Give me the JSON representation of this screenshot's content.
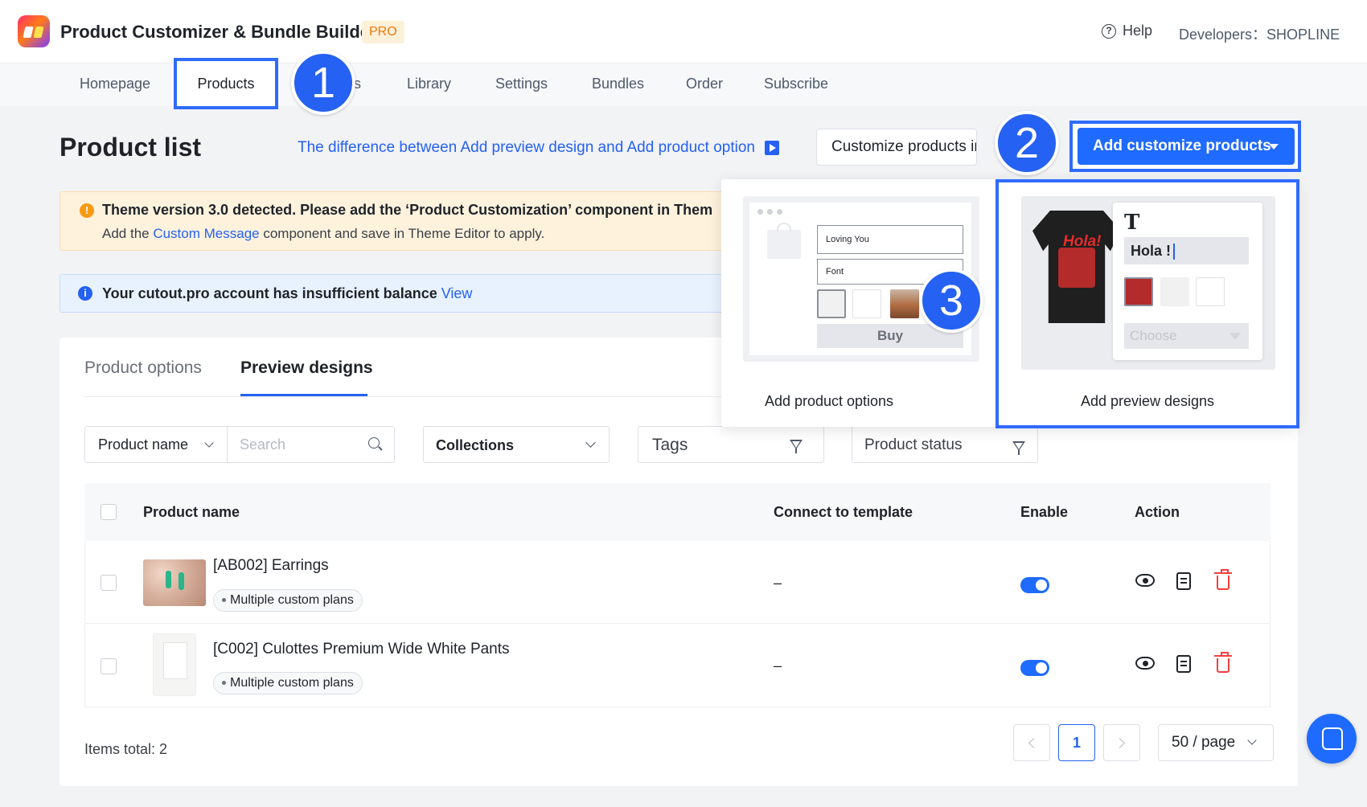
{
  "app": {
    "title": "Product Customizer & Bundle Builder",
    "badge": "PRO"
  },
  "header": {
    "help_label": "Help",
    "developers_label": "Developers：SHOPLINE"
  },
  "nav": {
    "items": [
      "Homepage",
      "Products",
      "s",
      "Library",
      "Settings",
      "Bundles",
      "Order",
      "Subscribe"
    ],
    "active": "Products"
  },
  "callouts": [
    "1",
    "2",
    "3"
  ],
  "page": {
    "title": "Product list",
    "difference_link": "The difference between Add preview design and Add product option",
    "bulk_button": "Customize products in b",
    "add_button": "Add customize products"
  },
  "warning": {
    "title": "Theme version 3.0 detected. Please add the ‘Product Customization’ component in Them",
    "sub_before": "Add the ",
    "sub_link": "Custom Message",
    "sub_after": " component and save in Theme Editor to apply."
  },
  "info": {
    "text": "Your cutout.pro account has insufficient balance",
    "link": "View"
  },
  "tabs": {
    "options": "Product options",
    "preview": "Preview designs"
  },
  "filters": {
    "name_select": "Product name",
    "search_placeholder": "Search",
    "collections": "Collections",
    "tags": "Tags",
    "status": "Product status"
  },
  "table": {
    "headers": {
      "name": "Product name",
      "template": "Connect to template",
      "enable": "Enable",
      "action": "Action"
    },
    "rows": [
      {
        "name": "[AB002] Earrings",
        "tag": "Multiple custom plans",
        "template": "–",
        "enabled": true
      },
      {
        "name": "[C002] Culottes Premium Wide White Pants",
        "tag": "Multiple custom plans",
        "template": "–",
        "enabled": true
      }
    ]
  },
  "footer": {
    "items_total": "Items total: 2",
    "current_page": "1",
    "page_size": "50 / page"
  },
  "dropdown": {
    "product_options": {
      "label": "Add product options",
      "mock_input": "Loving You",
      "mock_font": "Font",
      "mock_buy": "Buy"
    },
    "preview_designs": {
      "label": "Add preview designs",
      "tee_text": "Hola!",
      "t_icon": "T",
      "mock_text": "Hola !",
      "mock_choose": "Choose"
    }
  },
  "colors": {
    "primary": "#1f6bff",
    "highlight": "#2f6bff",
    "warning": "#f79a12",
    "danger": "#f53f3f"
  }
}
